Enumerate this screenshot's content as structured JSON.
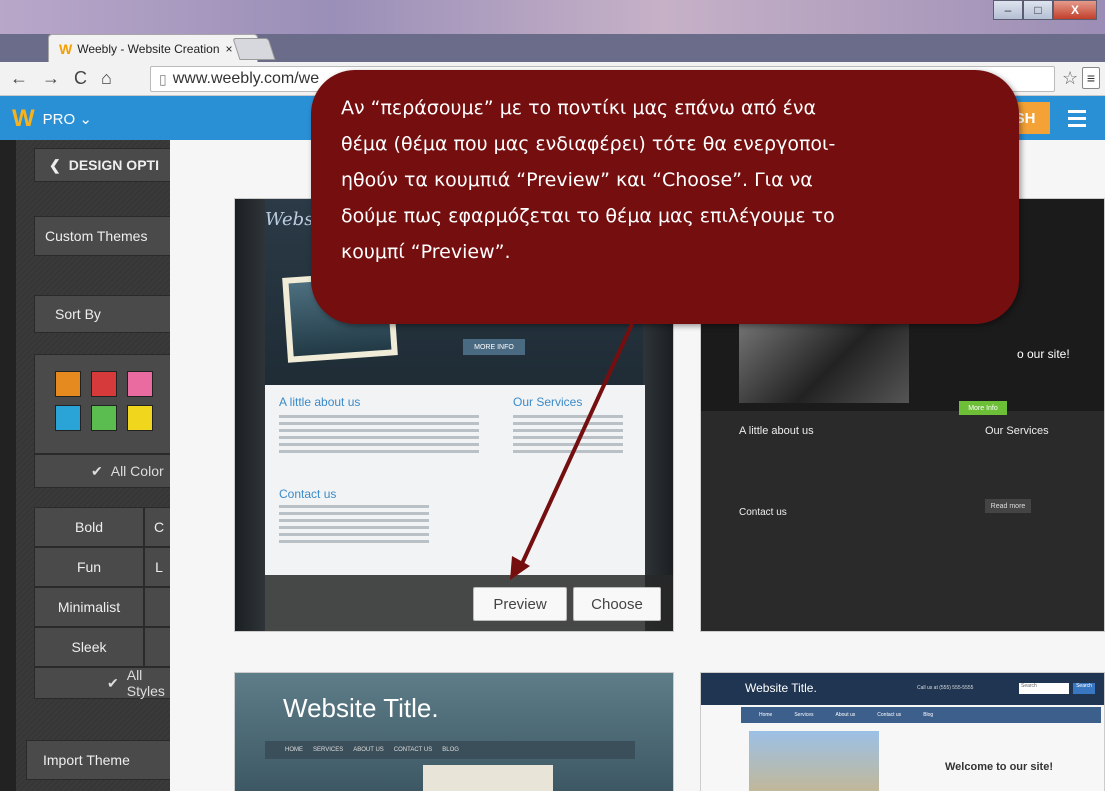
{
  "browser": {
    "tab_title": "Weebly - Website Creation",
    "tab_close": "×",
    "url": "www.weebly.com/we",
    "window_buttons": {
      "minimize": "–",
      "maximize": "□",
      "close": "X"
    }
  },
  "weebly_bar": {
    "logo": "W",
    "plan": "PRO ⌄",
    "publish_label": "SH"
  },
  "sidebar": {
    "back_label": "DESIGN OPTI",
    "custom_themes": "Custom Themes",
    "sort_by": "Sort By",
    "swatches": [
      "#e58a1f",
      "#d63a3a",
      "#ea6ba0",
      "#2aa3d6",
      "#5bbd4f",
      "#f0d61c"
    ],
    "all_colors": "All Color",
    "styles": [
      "Bold",
      "C",
      "Fun",
      "L",
      "Minimalist",
      "",
      "Sleek",
      ""
    ],
    "all_styles": "All Styles",
    "import_theme": "Import Theme"
  },
  "themes": {
    "t1": {
      "logo": "Websit",
      "more_info": "MORE INFO",
      "about": "A little about us",
      "services": "Our Services",
      "contact": "Contact us",
      "preview": "Preview",
      "choose": "Choose"
    },
    "t2": {
      "welcome": "o our site!",
      "more_info": "More Info",
      "about": "A little about us",
      "services": "Our Services",
      "read_more": "Read more",
      "contact": "Contact us"
    },
    "t3": {
      "title": "Website Title.",
      "nav": [
        "HOME",
        "SERVICES",
        "ABOUT US",
        "CONTACT US",
        "BLOG"
      ]
    },
    "t4": {
      "title": "Website Title.",
      "call": "Call us at (555) 555-5555",
      "search_placeholder": "Search",
      "search_btn": "Search",
      "nav": [
        "Home",
        "Services",
        "About us",
        "Contact us",
        "Blog"
      ],
      "welcome": "Welcome to our site!"
    }
  },
  "callout": {
    "line1": "Αν “περάσουμε” με το ποντίκι μας επάνω από ένα",
    "line2": "θέμα (θέμα που μας ενδιαφέρει) τότε θα ενεργοποι-",
    "line3": "ηθούν τα κουμπιά “Preview” και  “Choose”.  Για να",
    "line4": "δούμε πως εφαρμόζεται το θέμα μας επιλέγουμε το",
    "line5": "κουμπί “Preview”."
  }
}
